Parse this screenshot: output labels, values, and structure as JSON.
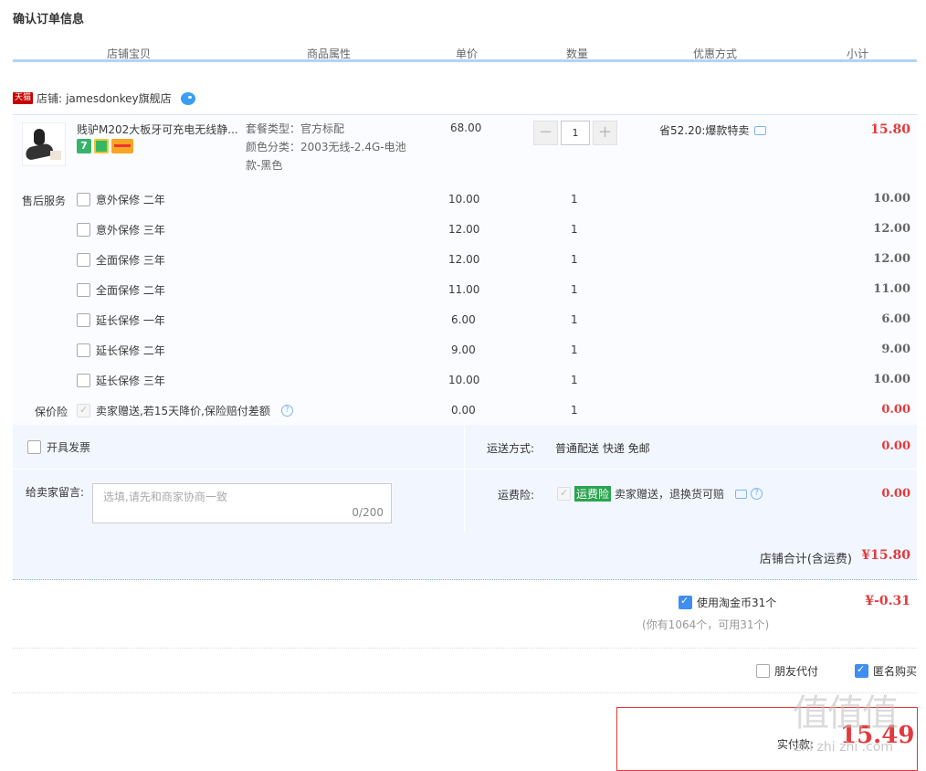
{
  "page_title": "确认订单信息",
  "headers": [
    "店铺宝贝",
    "商品属性",
    "单价",
    "数量",
    "优惠方式",
    "小计"
  ],
  "shop": {
    "badge": "天猫",
    "label": "店铺:",
    "name": "jamesdonkey旗舰店"
  },
  "product": {
    "name": "贱驴M202大板牙可充电无线静...",
    "badges": [
      "7-day-return-badge",
      "shield-badge",
      "credit-card-badge"
    ],
    "sku_type": "套餐类型：官方标配",
    "sku_color_1": "颜色分类：2003无线-2.4G-电池",
    "sku_color_2": "款-黑色",
    "price": "68.00",
    "qty": "1",
    "promo": "省52.20:爆款特卖",
    "subtotal": "15.80"
  },
  "after_sales_label": "售后服务",
  "services": [
    {
      "name": "意外保修 二年",
      "price": "10.00",
      "qty": "1",
      "subtotal": "10.00"
    },
    {
      "name": "意外保修 三年",
      "price": "12.00",
      "qty": "1",
      "subtotal": "12.00"
    },
    {
      "name": "全面保修 三年",
      "price": "12.00",
      "qty": "1",
      "subtotal": "12.00"
    },
    {
      "name": "全面保修 二年",
      "price": "11.00",
      "qty": "1",
      "subtotal": "11.00"
    },
    {
      "name": "延长保修 一年",
      "price": "6.00",
      "qty": "1",
      "subtotal": "6.00"
    },
    {
      "name": "延长保修 二年",
      "price": "9.00",
      "qty": "1",
      "subtotal": "9.00"
    },
    {
      "name": "延长保修 三年",
      "price": "10.00",
      "qty": "1",
      "subtotal": "10.00"
    }
  ],
  "price_protect": {
    "label": "保价险",
    "text": "卖家赠送,若15天降价,保险赔付差额",
    "price": "0.00",
    "qty": "1",
    "subtotal": "0.00"
  },
  "invoice_label": "开具发票",
  "shipping": {
    "label": "运送方式:",
    "value": "普通配送 快递 免邮",
    "subtotal": "0.00"
  },
  "message": {
    "label": "给卖家留言:",
    "placeholder": "选填,请先和商家协商一致",
    "count": "0/200"
  },
  "freight_ins": {
    "label": "运费险:",
    "tag": "运费险",
    "text": "卖家赠送，退换货可赔",
    "subtotal": "0.00"
  },
  "shop_total": {
    "label": "店铺合计(含运费)",
    "value": "¥15.80"
  },
  "coins": {
    "label": "使用淘金币31个",
    "sub": "(你有1064个，可用31个)",
    "value": "¥-0.31"
  },
  "friend_pay": "朋友代付",
  "anonymous": "匿名购买",
  "pay": {
    "label": "实付款:",
    "amount": "15.49"
  },
  "watermark": {
    "big": "值值值",
    "small": "zhi zhi zhi .com"
  }
}
